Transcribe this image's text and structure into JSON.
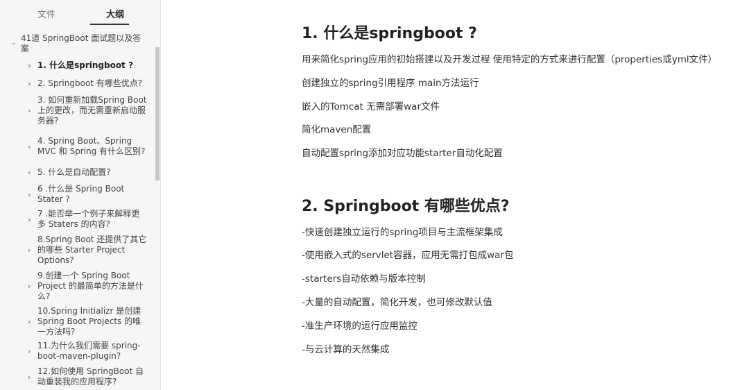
{
  "sidebar": {
    "tabs": [
      "文件",
      "大纲"
    ],
    "root": "41道 SpringBoot 面试题以及答案",
    "items": [
      {
        "label": "1. 什么是springboot ?"
      },
      {
        "label": "2. Springboot 有哪些优点?"
      },
      {
        "label": "3. 如何重新加载Spring Boot上的更改，而无需重新启动服务器?"
      },
      {
        "label": "4. Spring Boot、Spring MVC 和 Spring 有什么区别?"
      },
      {
        "label": "5. 什么是自动配置?"
      },
      {
        "label": "6 .什么是 Spring Boot Stater ?"
      },
      {
        "label": "7 .能否举一个例子来解释更多 Staters 的内容?"
      },
      {
        "label": "8.Spring Boot 还提供了其它的哪些 Starter Project Options?"
      },
      {
        "label": "9.创建一个 Spring Boot Project 的最简单的方法是什么?"
      },
      {
        "label": "10.Spring Initializr 是创建 Spring Boot Projects 的唯一方法吗?"
      },
      {
        "label": "11.为什么我们需要 spring-boot-maven-plugin?"
      },
      {
        "label": "12.如何使用 SpringBoot 自动重装我的应用程序?"
      }
    ]
  },
  "content": {
    "sections": [
      {
        "title": "1. 什么是springboot ?",
        "paragraphs": [
          "用来简化spring应用的初始搭建以及开发过程 使用特定的方式来进行配置（properties或yml文件）",
          "创建独立的spring引用程序 main方法运行",
          "嵌入的Tomcat 无需部署war文件",
          "简化maven配置",
          "自动配置spring添加对应功能starter自动化配置"
        ]
      },
      {
        "title": "2. Springboot 有哪些优点?",
        "paragraphs": [
          "-快速创建独立运行的spring项目与主流框架集成",
          "-使用嵌入式的servlet容器，应用无需打包成war包",
          "-starters自动依赖与版本控制",
          "-大量的自动配置，简化开发，也可修改默认值",
          "-准生产环境的运行应用监控",
          "-与云计算的天然集成"
        ]
      }
    ]
  }
}
